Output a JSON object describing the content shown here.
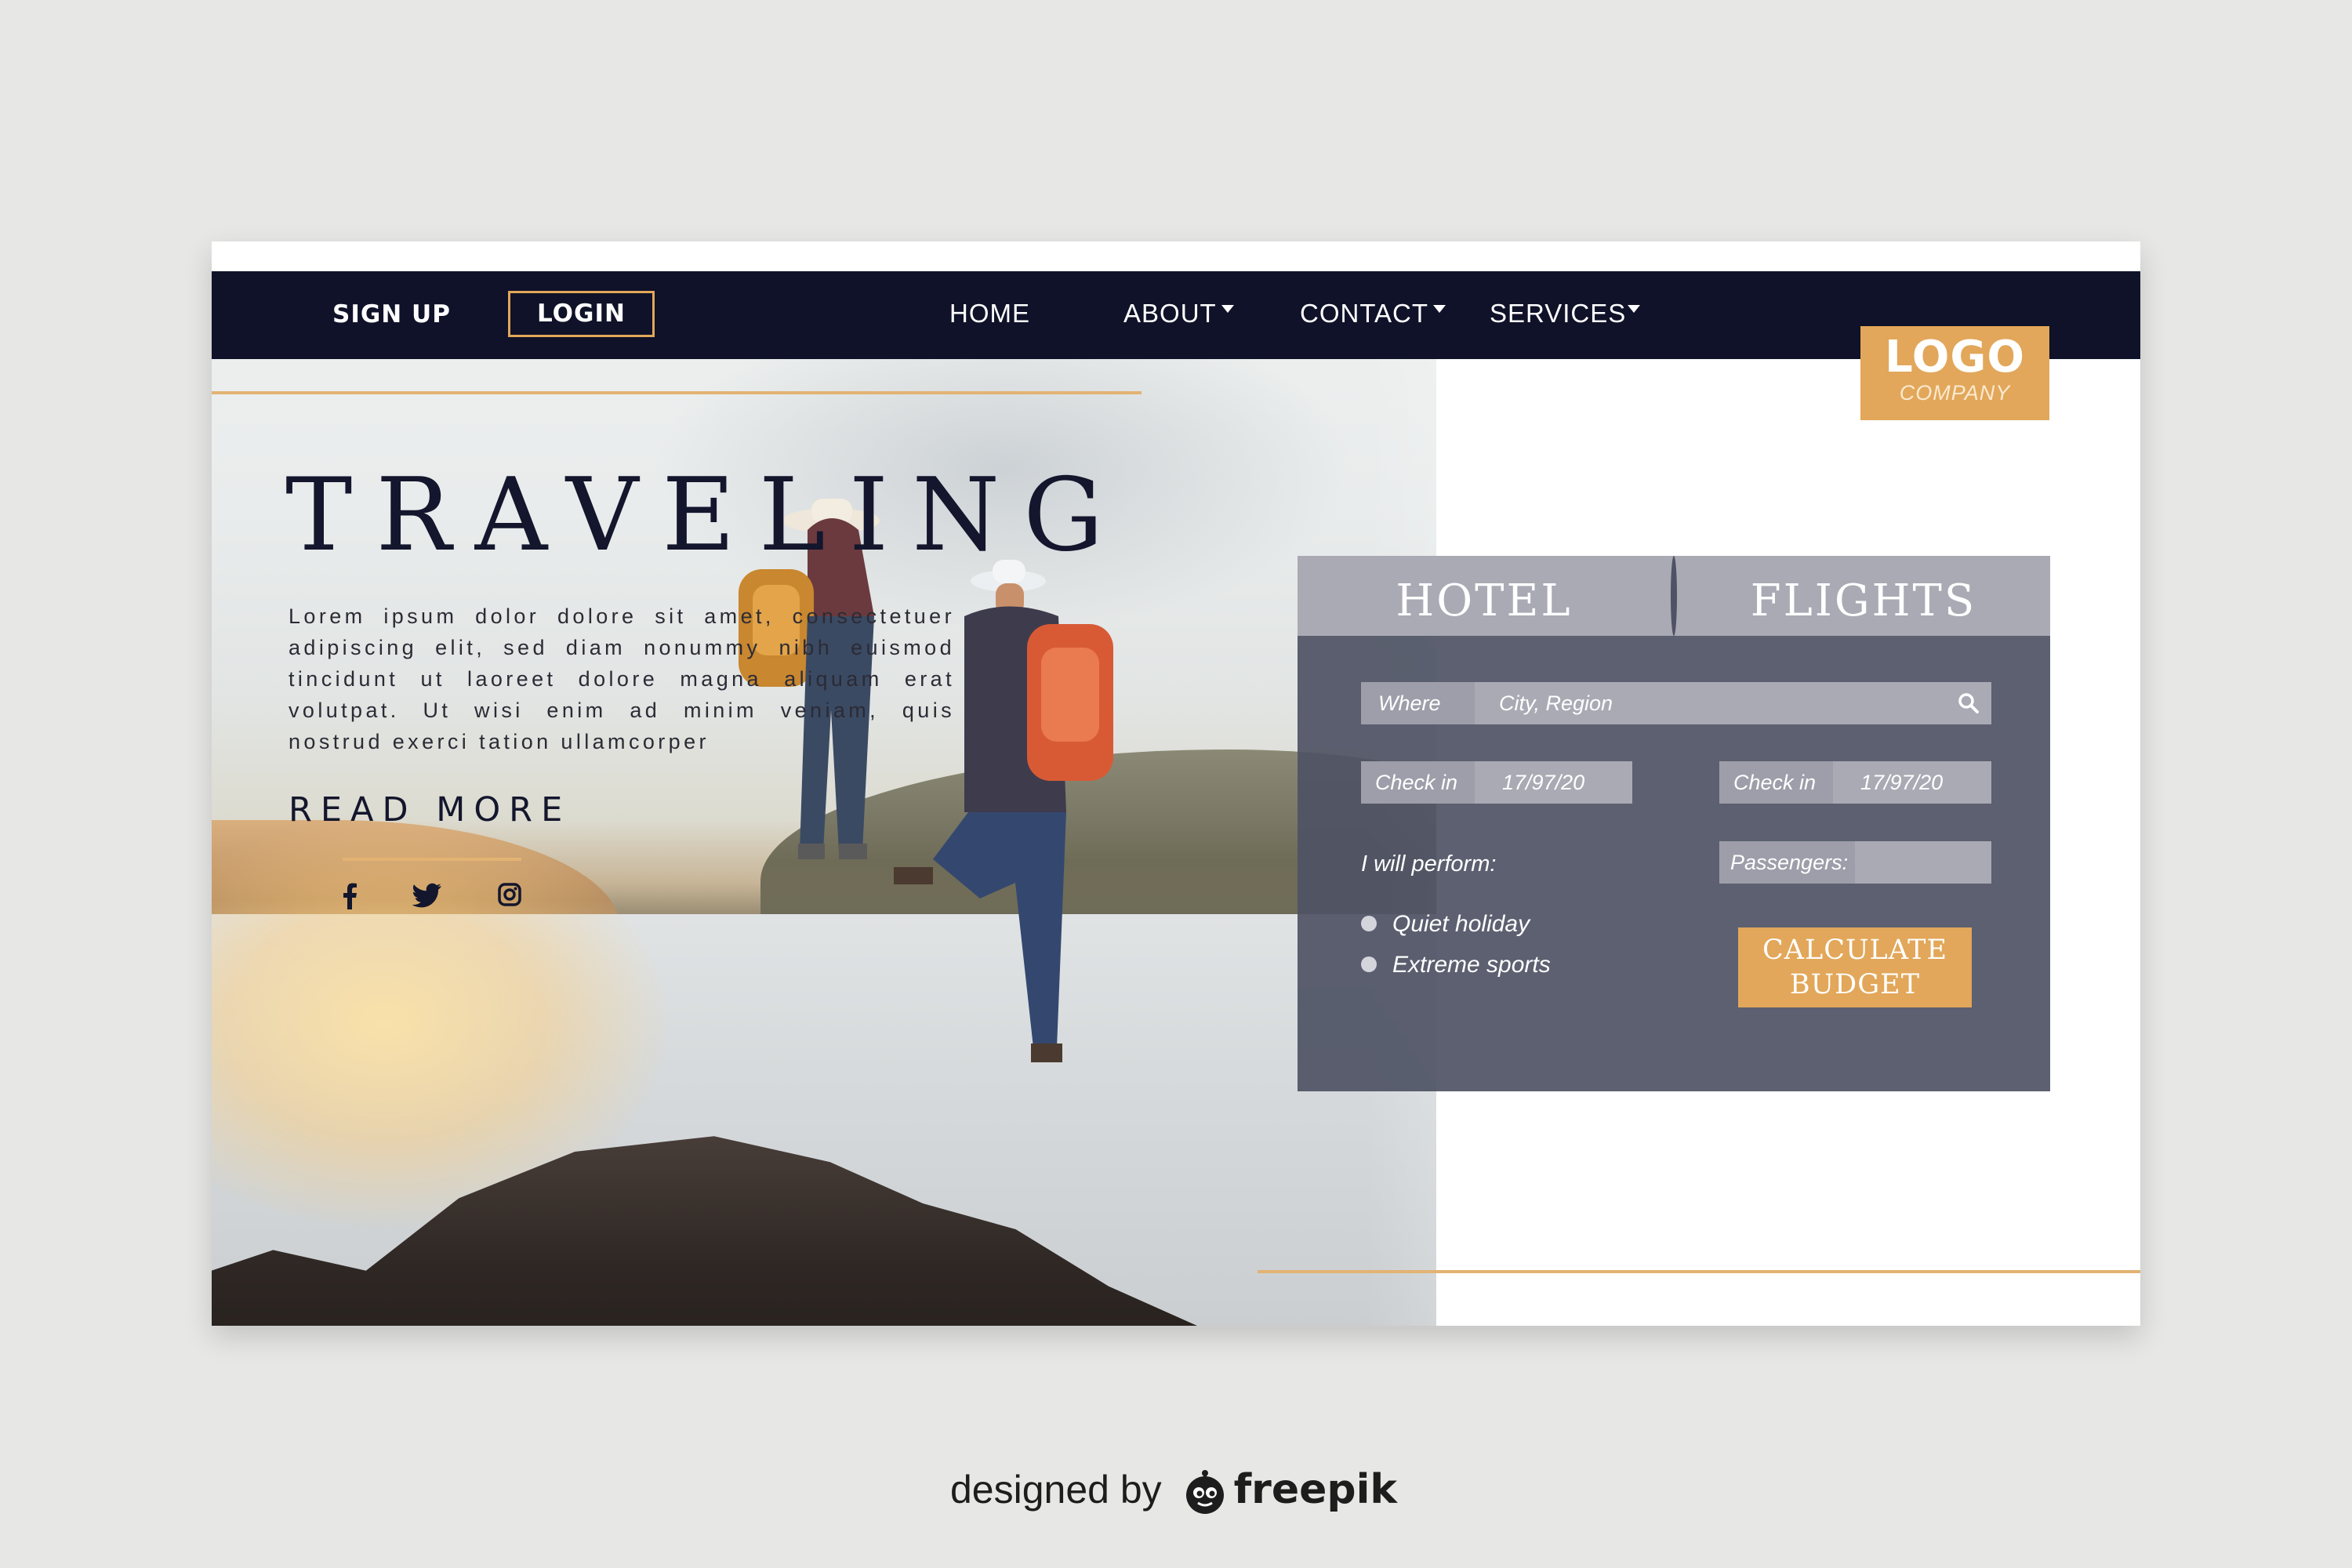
{
  "nav": {
    "sign_up": "SIGN UP",
    "login": "LOGIN",
    "items": [
      {
        "label": "HOME",
        "has_dropdown": false
      },
      {
        "label": "ABOUT",
        "has_dropdown": true
      },
      {
        "label": "CONTACT",
        "has_dropdown": true
      },
      {
        "label": "SERVICES",
        "has_dropdown": true
      }
    ]
  },
  "logo": {
    "main": "LOGO",
    "sub": "COMPANY"
  },
  "hero": {
    "title": "TRAVELING",
    "body": "Lorem ipsum dolor dolore sit amet, consectetuer adipiscing elit, sed diam nonummy nibh euismod tincidunt ut laoreet dolore magna aliquam erat volutpat. Ut wisi enim ad minim veniam, quis nostrud exerci tation ullamcorper",
    "read_more": "READ MORE",
    "social": [
      "facebook-icon",
      "twitter-icon",
      "instagram-icon"
    ]
  },
  "booking": {
    "tabs": [
      "HOTEL",
      "FLIGHTS"
    ],
    "where_label": "Where",
    "where_placeholder": "City, Region",
    "checkin_left_label": "Check in",
    "checkin_left_value": "17/97/20",
    "checkin_right_label": "Check in",
    "checkin_right_value": "17/97/20",
    "passengers_label": "Passengers:",
    "perform_label": "I will perform:",
    "options": [
      "Quiet holiday",
      "Extreme sports"
    ],
    "calculate_line1": "CALCULATE",
    "calculate_line2": "BUDGET"
  },
  "credit": {
    "prefix": "designed by",
    "brand": "freepik"
  },
  "colors": {
    "navbar": "#0f1228",
    "accent_gold": "#e2a75a",
    "panel": "#4e5264",
    "tab_bar": "#a9aab4",
    "background": "#e7e8e6"
  }
}
